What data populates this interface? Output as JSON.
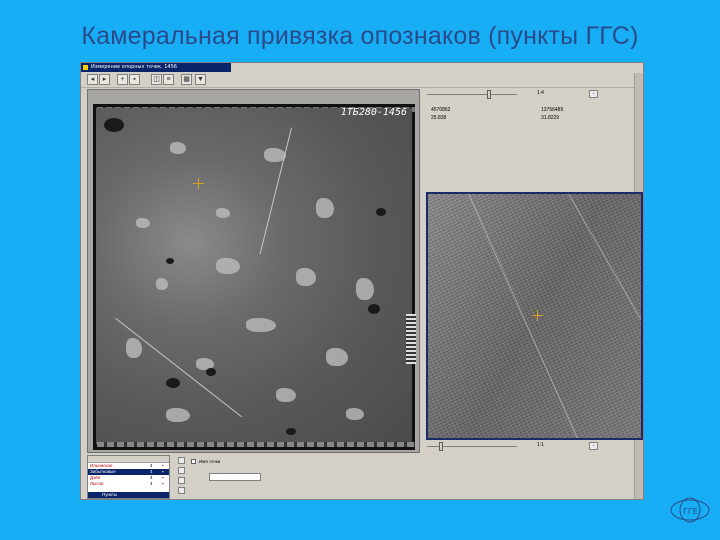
{
  "slide": {
    "title": "Камеральная привязка опознаков (пункты ГГС)"
  },
  "window": {
    "title": "Измерение опорных точек. 1456",
    "toolbar_icons": [
      "back-icon",
      "forward-icon",
      "point-icon",
      "image-icon",
      "view-icon",
      "settings-icon",
      "grid-icon",
      "marker-icon"
    ]
  },
  "photo": {
    "label": "1ТБ280-1456"
  },
  "right_panel": {
    "zoom_top": "1:4",
    "zoom_bottom": "1:1",
    "coords": {
      "a1": "4570862",
      "a2": "13756489",
      "b1": "25.838",
      "b2": "31.8229"
    }
  },
  "point_list": {
    "rows": [
      {
        "name": "Ильинское",
        "value": "4"
      },
      {
        "name": "Забытковые",
        "value": "4"
      },
      {
        "name": "Дзёя",
        "value": "4"
      },
      {
        "name": "Лысое",
        "value": "4"
      }
    ],
    "footer": "Пункты"
  },
  "name_field": {
    "label": "Имя точки"
  },
  "logo": {
    "text": "ГГЕ"
  }
}
